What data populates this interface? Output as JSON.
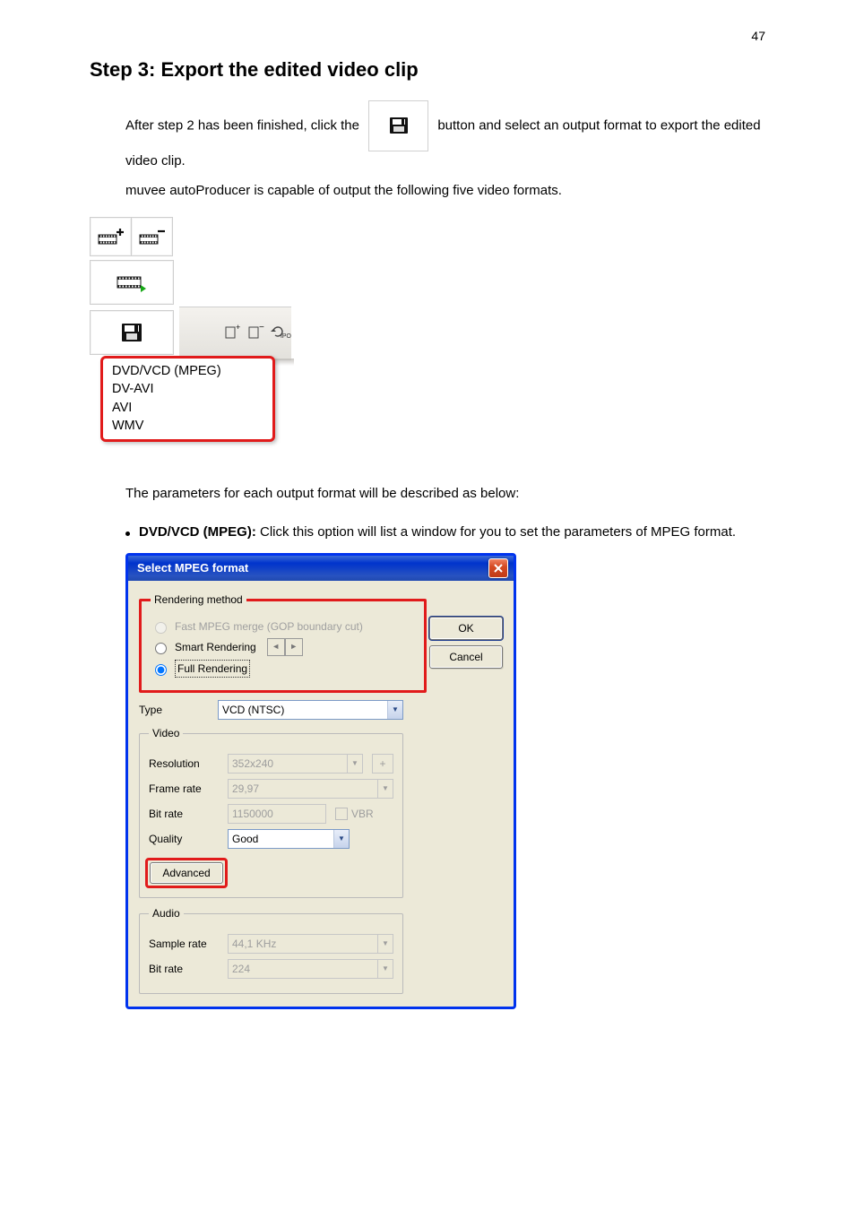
{
  "pageNum": "47",
  "heading": "Step 3: Export the edited video clip",
  "intro_pre": "After step 2 has been finished, click the",
  "intro_post": "button and select an output format to export the edited video clip.",
  "intro_line2": "muvee autoProducer is capable of output the following five video formats.",
  "menu": {
    "items": [
      "DVD/VCD (MPEG)",
      "DV-AVI",
      "AVI",
      "WMV"
    ]
  },
  "out_text": "The parameters for each output format will be described as below:",
  "bullet_1": {
    "title": "DVD/VCD (MPEG):",
    "text": "Click this option will list a window for you to set the parameters of MPEG format."
  },
  "dialog": {
    "title": "Select MPEG format",
    "ok": "OK",
    "cancel": "Cancel",
    "rendering_legend": "Rendering method",
    "r1": "Fast MPEG merge (GOP boundary cut)",
    "r2": "Smart Rendering",
    "r3": "Full Rendering",
    "type_label": "Type",
    "type_value": "VCD (NTSC)",
    "video_legend": "Video",
    "res_label": "Resolution",
    "res_value": "352x240",
    "fr_label": "Frame rate",
    "fr_value": "29,97",
    "br_label": "Bit rate",
    "br_value": "1150000",
    "vbr": "VBR",
    "q_label": "Quality",
    "q_value": "Good",
    "adv": "Advanced",
    "audio_legend": "Audio",
    "sr_label": "Sample rate",
    "sr_value": "44,1 KHz",
    "abr_label": "Bit rate",
    "abr_value": "224"
  }
}
